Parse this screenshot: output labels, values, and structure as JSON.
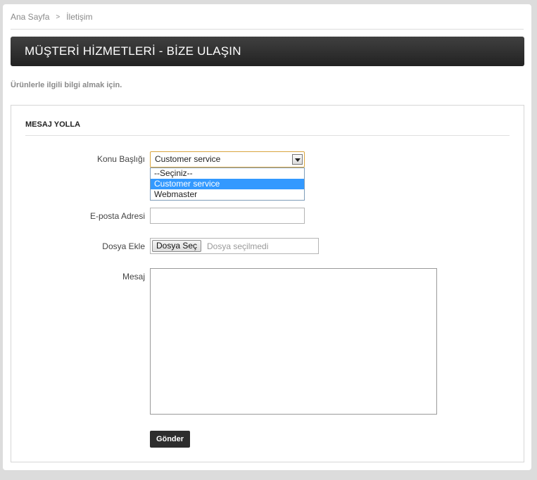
{
  "breadcrumb": {
    "home": "Ana Sayfa",
    "separator": ">",
    "current": "İletişim"
  },
  "page_title": "MÜŞTERİ HİZMETLERİ - BİZE ULAŞIN",
  "intro_text": "Ürünlerle ilgili bilgi almak için.",
  "form": {
    "section_title": "MESAJ YOLLA",
    "subject": {
      "label": "Konu Başlığı",
      "selected": "Customer service",
      "options": [
        "--Seçiniz--",
        "Customer service",
        "Webmaster"
      ]
    },
    "email": {
      "label": "E-posta Adresi",
      "value": ""
    },
    "attachment": {
      "label": "Dosya Ekle",
      "button_label": "Dosya Seç",
      "status": "Dosya seçilmedi"
    },
    "message": {
      "label": "Mesaj",
      "value": ""
    },
    "submit_label": "Gönder"
  },
  "colors": {
    "title_bar": "#2d2d2d",
    "selected_option": "#3399ff",
    "select_focus_border": "#d9a53f"
  }
}
